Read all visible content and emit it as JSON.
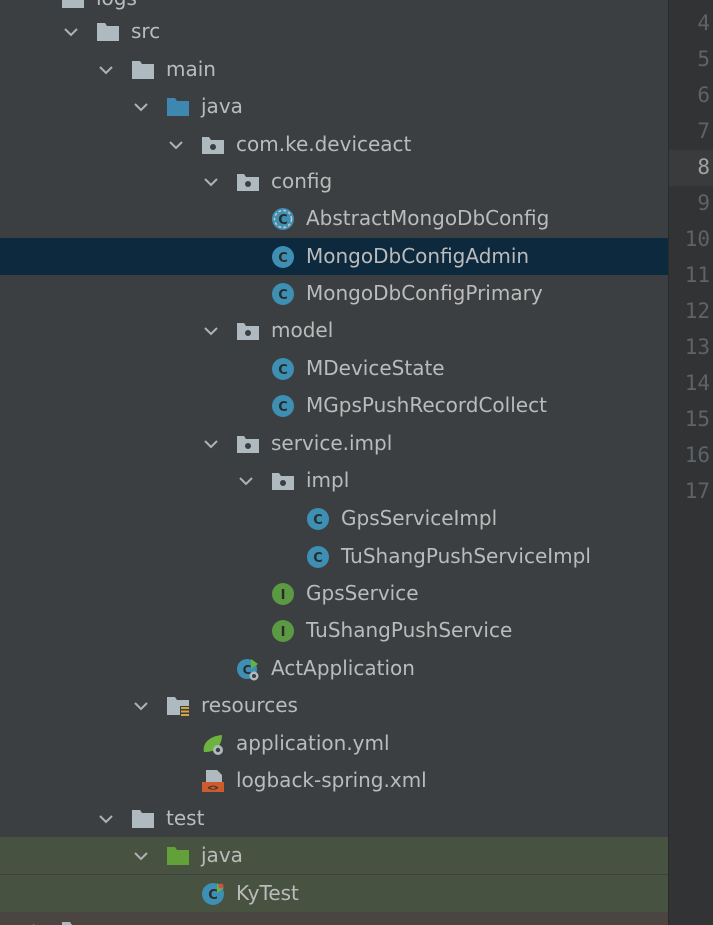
{
  "tree": {
    "nodes": [
      {
        "label": "logs",
        "icon": "folder-icon"
      },
      {
        "label": "src",
        "icon": "folder-icon"
      },
      {
        "label": "main",
        "icon": "folder-icon"
      },
      {
        "label": "java",
        "icon": "source-folder-icon"
      },
      {
        "label": "com.ke.deviceact",
        "icon": "package-icon"
      },
      {
        "label": "config",
        "icon": "package-icon"
      },
      {
        "label": "AbstractMongoDbConfig",
        "icon": "abstract-class-icon"
      },
      {
        "label": "MongoDbConfigAdmin",
        "icon": "class-icon",
        "selected": true
      },
      {
        "label": "MongoDbConfigPrimary",
        "icon": "class-icon"
      },
      {
        "label": "model",
        "icon": "package-icon"
      },
      {
        "label": "MDeviceState",
        "icon": "class-icon"
      },
      {
        "label": "MGpsPushRecordCollect",
        "icon": "class-icon"
      },
      {
        "label": "service.impl",
        "icon": "package-icon"
      },
      {
        "label": "impl",
        "icon": "package-icon"
      },
      {
        "label": "GpsServiceImpl",
        "icon": "class-icon"
      },
      {
        "label": "TuShangPushServiceImpl",
        "icon": "class-icon"
      },
      {
        "label": "GpsService",
        "icon": "interface-icon"
      },
      {
        "label": "TuShangPushService",
        "icon": "interface-icon"
      },
      {
        "label": "ActApplication",
        "icon": "spring-boot-app-icon"
      },
      {
        "label": "resources",
        "icon": "resources-folder-icon"
      },
      {
        "label": "application.yml",
        "icon": "spring-config-icon"
      },
      {
        "label": "logback-spring.xml",
        "icon": "xml-file-icon"
      },
      {
        "label": "test",
        "icon": "folder-icon"
      },
      {
        "label": "java",
        "icon": "test-source-folder-icon"
      },
      {
        "label": "KyTest",
        "icon": "test-class-icon"
      },
      {
        "label": "",
        "icon": "folder-icon"
      }
    ]
  },
  "gutter": {
    "line_numbers": [
      "4",
      "5",
      "6",
      "7",
      "8",
      "9",
      "10",
      "11",
      "12",
      "13",
      "14",
      "15",
      "16",
      "17"
    ],
    "current_line": "8"
  },
  "colors": {
    "panel_bg": "#3c3f41",
    "selection": "#0d293e",
    "test_highlight": "#475240",
    "class_icon": "#3d8fb3",
    "interface_icon": "#5b9a43",
    "folder_icon": "#aeb9c0",
    "source_folder_icon": "#3d87b0",
    "test_folder_icon": "#62a03a"
  }
}
